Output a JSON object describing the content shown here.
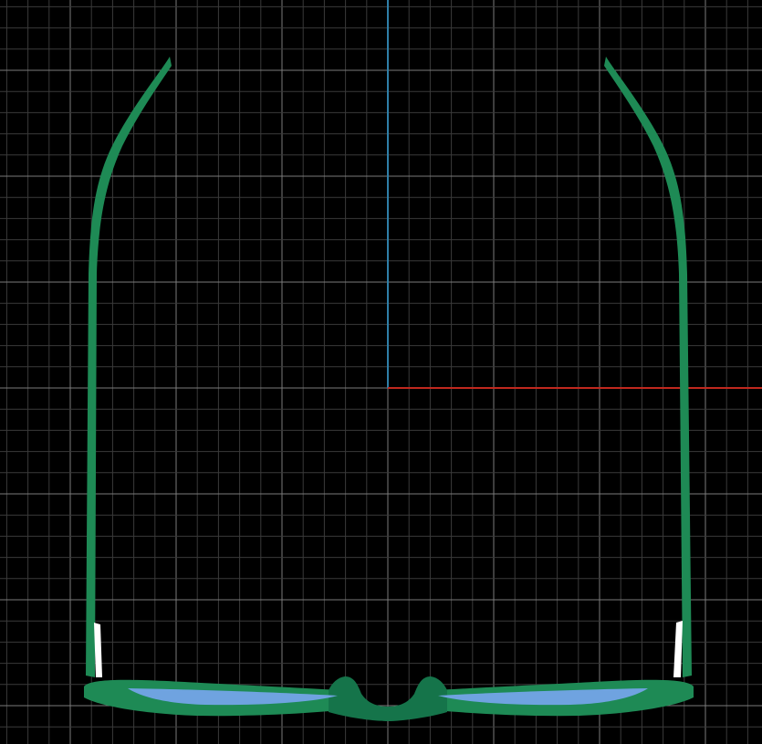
{
  "viewport": {
    "view": "top",
    "background_color": "#000000",
    "grid": {
      "visible": true,
      "minor_color": "#3a3a3a",
      "major_color": "#7a7a7a"
    },
    "axes": {
      "y_axis_color": "#2f7fa8",
      "x_axis_color": "#c0281e"
    }
  },
  "model": {
    "name": "eyeglasses",
    "frame_color": "#1e8a55",
    "frame_shade_color": "#15744a",
    "lens_color": "#6fa3e0",
    "hinge_color": "#ffffff"
  }
}
